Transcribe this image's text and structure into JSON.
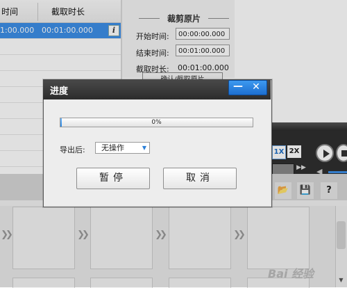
{
  "list": {
    "header": {
      "start_col_label": "时间",
      "duration_col_label": "截取时长"
    },
    "selected_row": {
      "start_time": "1:00.000",
      "duration": "00:01:00.000"
    },
    "info_button_label": "i"
  },
  "crop_panel": {
    "title": "裁剪原片",
    "start_time_label": "开始时间:",
    "start_time_value": "00:00:00.000",
    "end_time_label": "结束时间:",
    "end_time_value": "00:01:00.000",
    "duration_label": "截取时长:",
    "duration_value": "00:01:00.000",
    "action_button_label": "确认/截取原片"
  },
  "player": {
    "speed_1x_label": "1X",
    "speed_2x_label": "2X",
    "fast_forward_glyph": "▶▶",
    "volume_glyph": "◀"
  },
  "toolbar": {
    "open_folder_glyph": "📂",
    "save_glyph": "💾",
    "help_glyph": "?"
  },
  "filmstrip": {
    "chevron_glyph": "❯❯",
    "scroll_down_glyph": "▼"
  },
  "watermark": "Bai 经验",
  "progress_dialog": {
    "title": "进度",
    "minimize_glyph": "—",
    "close_glyph": "✕",
    "progress_percent": 0,
    "progress_text": "0%",
    "after_export_label": "导出后:",
    "after_export_value": "无操作",
    "dropdown_arrow": "▼",
    "pause_button_label": "暂停",
    "cancel_button_label": "取消"
  },
  "colors": {
    "accent": "#2a85df",
    "titlebar": "#2c2c2c",
    "selected_row": "#3d8fe8"
  }
}
